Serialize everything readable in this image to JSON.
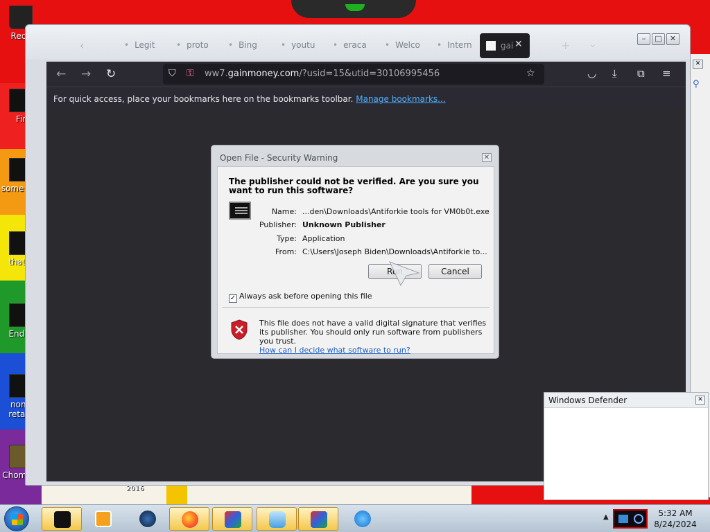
{
  "desktop": {
    "icons": [
      {
        "label": "Recy"
      },
      {
        "label": "Fir"
      },
      {
        "label": "some ran"
      },
      {
        "label": "thatib"
      },
      {
        "label": "Ender"
      },
      {
        "label": "none retarc"
      },
      {
        "label": "ChomikB"
      }
    ],
    "wallpaper_text": "2016"
  },
  "browser": {
    "tabs": [
      "Legit",
      "proto",
      "Bing",
      "youtu",
      "eraca",
      "Welco",
      "Intern"
    ],
    "active_tab": "gai",
    "url_prefix": "ww7.",
    "url_host": "gainmoney.com",
    "url_path": "/?usid=15&utid=30106995456",
    "bookmarks_text": "For quick access, place your bookmarks here on the bookmarks toolbar.",
    "bookmarks_link": "Manage bookmarks..."
  },
  "dialog": {
    "title": "Open File - Security Warning",
    "heading": "The publisher could not be verified.  Are you sure you want to run this software?",
    "rows": [
      {
        "key": "Name:",
        "value": "...den\\Downloads\\Antiforkie tools for VM0b0t.exe"
      },
      {
        "key": "Publisher:",
        "value": "Unknown Publisher"
      },
      {
        "key": "Type:",
        "value": "Application"
      },
      {
        "key": "From:",
        "value": "C:\\Users\\Joseph Biden\\Downloads\\Antiforkie to..."
      }
    ],
    "run_label": "Run",
    "cancel_label": "Cancel",
    "checkbox_label": "Always ask before opening this file",
    "checkbox_checked": true,
    "note": "This file does not have a valid digital signature that verifies its publisher.  You should only run software from publishers you trust.",
    "help_link": "How can I decide what software to run?"
  },
  "defender": {
    "title": "Windows Defender"
  },
  "taskbar": {
    "time": "5:32 AM",
    "date": "8/24/2024"
  },
  "colors": {
    "wallpaper_red": "#e61010",
    "browser_dark": "#2b2a33",
    "link_blue": "#4fb0ff"
  }
}
